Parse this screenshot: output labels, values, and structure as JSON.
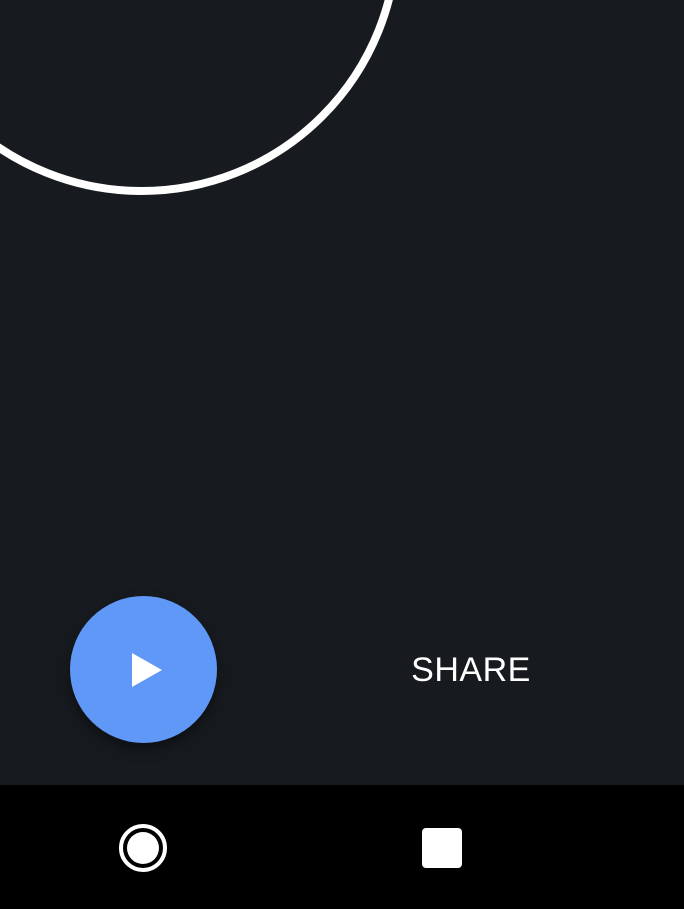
{
  "app": {
    "share_label": "SHARE",
    "play_icon": "play-icon",
    "colors": {
      "background": "#171b1f",
      "fab": "#5f98f7",
      "ring": "#ffffff",
      "nav_bar": "#000000"
    }
  },
  "nav": {
    "home_icon": "home-circle-icon",
    "recents_icon": "recents-square-icon"
  }
}
